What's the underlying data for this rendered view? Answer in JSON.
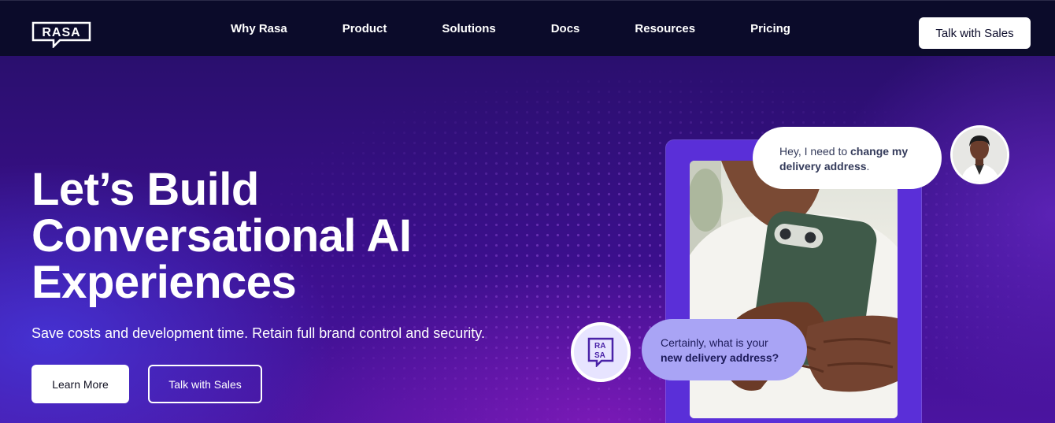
{
  "brand": {
    "logo_text": "RASA"
  },
  "nav": {
    "links": [
      {
        "label": "Why Rasa"
      },
      {
        "label": "Product"
      },
      {
        "label": "Solutions"
      },
      {
        "label": "Docs"
      },
      {
        "label": "Resources"
      },
      {
        "label": "Pricing"
      }
    ],
    "cta_label": "Talk with Sales"
  },
  "hero": {
    "headline_lines": [
      "Let’s Build",
      "Conversational AI",
      "Experiences"
    ],
    "subtitle": "Save costs and development time. Retain full brand control and security.",
    "primary_button": "Learn More",
    "secondary_button": "Talk with Sales"
  },
  "chat": {
    "user_message_plain": "Hey, I need to ",
    "user_message_bold": "change my delivery address",
    "user_message_end": ".",
    "bot_message_plain": "Certainly, what is your ",
    "bot_message_bold": "new delivery address?",
    "bot_logo_text": "RASA"
  },
  "colors": {
    "nav_bg": "#0b0b2a",
    "hero_purple": "#3b0f8c",
    "frame_purple": "#5a2fd8",
    "bot_bubble": "#a9a4f5"
  }
}
